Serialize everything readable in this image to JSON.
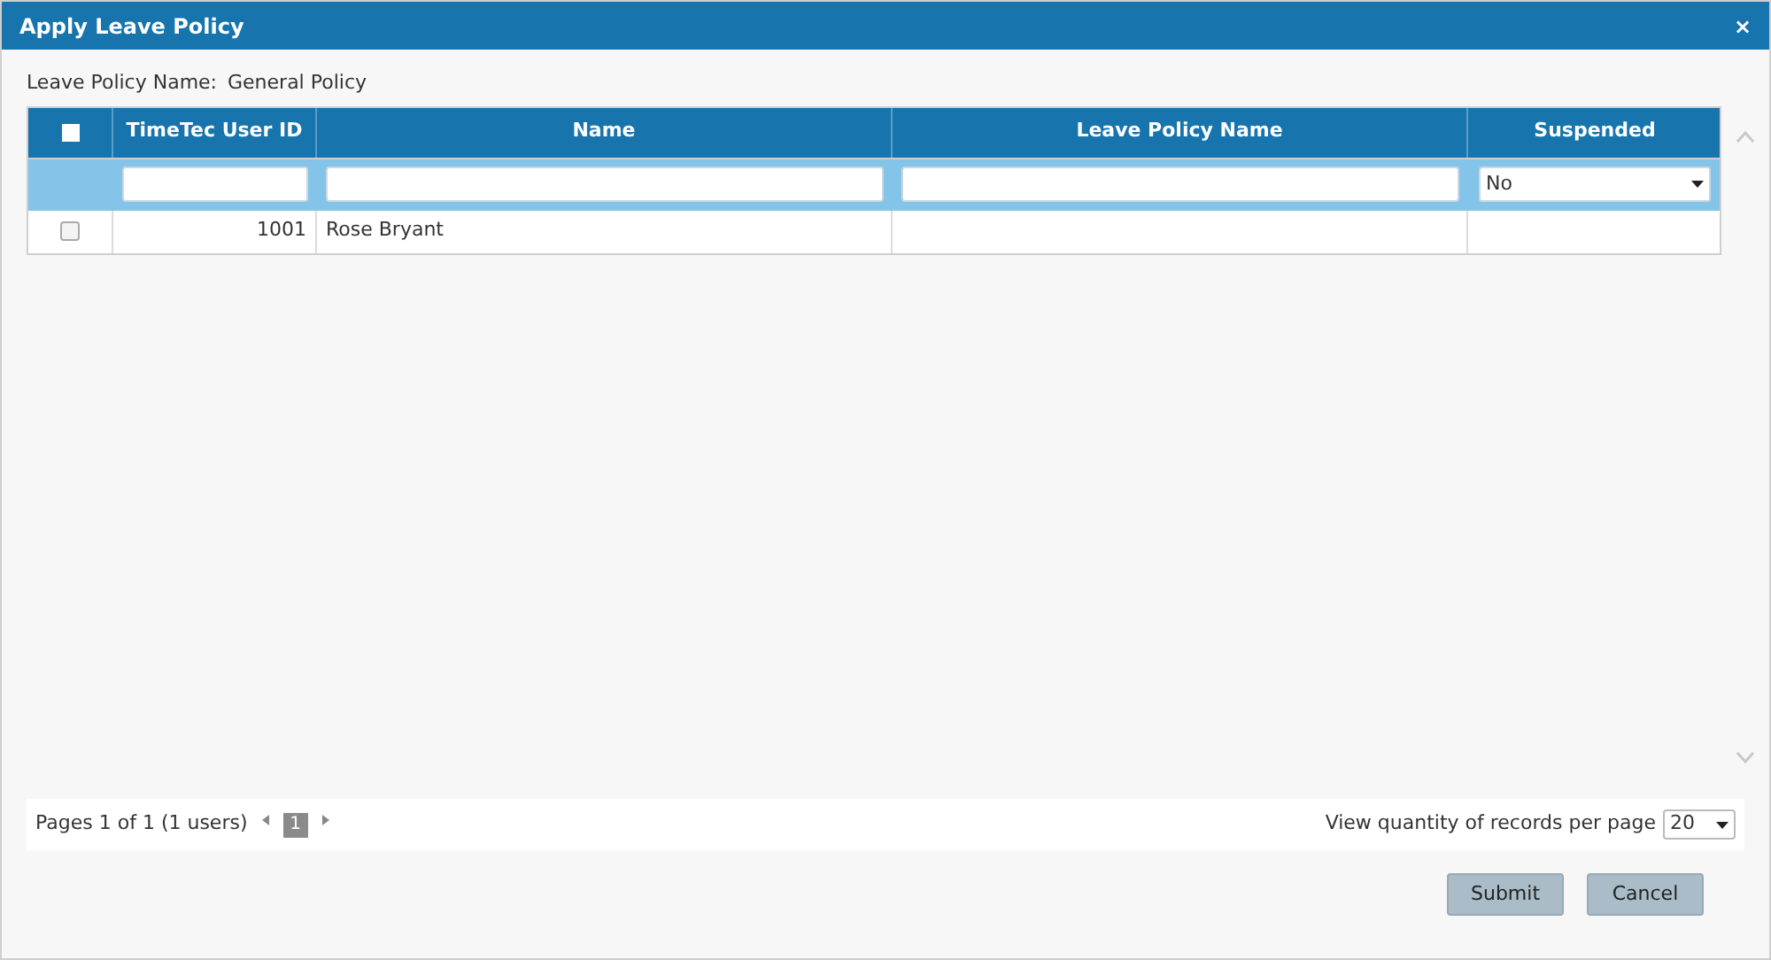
{
  "window": {
    "title": "Apply Leave Policy",
    "close": "×"
  },
  "policy": {
    "label": "Leave Policy Name:",
    "value": "General Policy"
  },
  "table": {
    "select_all": {
      "checked": false
    },
    "columns": [
      "TimeTec User ID",
      "Name",
      "Leave Policy Name",
      "Suspended"
    ],
    "filters": [
      {
        "kind": "text"
      },
      {
        "kind": "text"
      },
      {
        "kind": "text"
      },
      {
        "kind": "select",
        "value": "No"
      }
    ],
    "rows": [
      {
        "checked": false,
        "cells": [
          "1001",
          "Rose Bryant",
          "",
          ""
        ]
      }
    ]
  },
  "pagination": {
    "summary": "Pages 1 of 1 (1 users)",
    "pages": [
      {
        "label": "1",
        "selected": true
      }
    ],
    "per_page_label": "View quantity of records per page",
    "per_page": "20"
  },
  "buttons": [
    "Submit",
    "Cancel"
  ]
}
